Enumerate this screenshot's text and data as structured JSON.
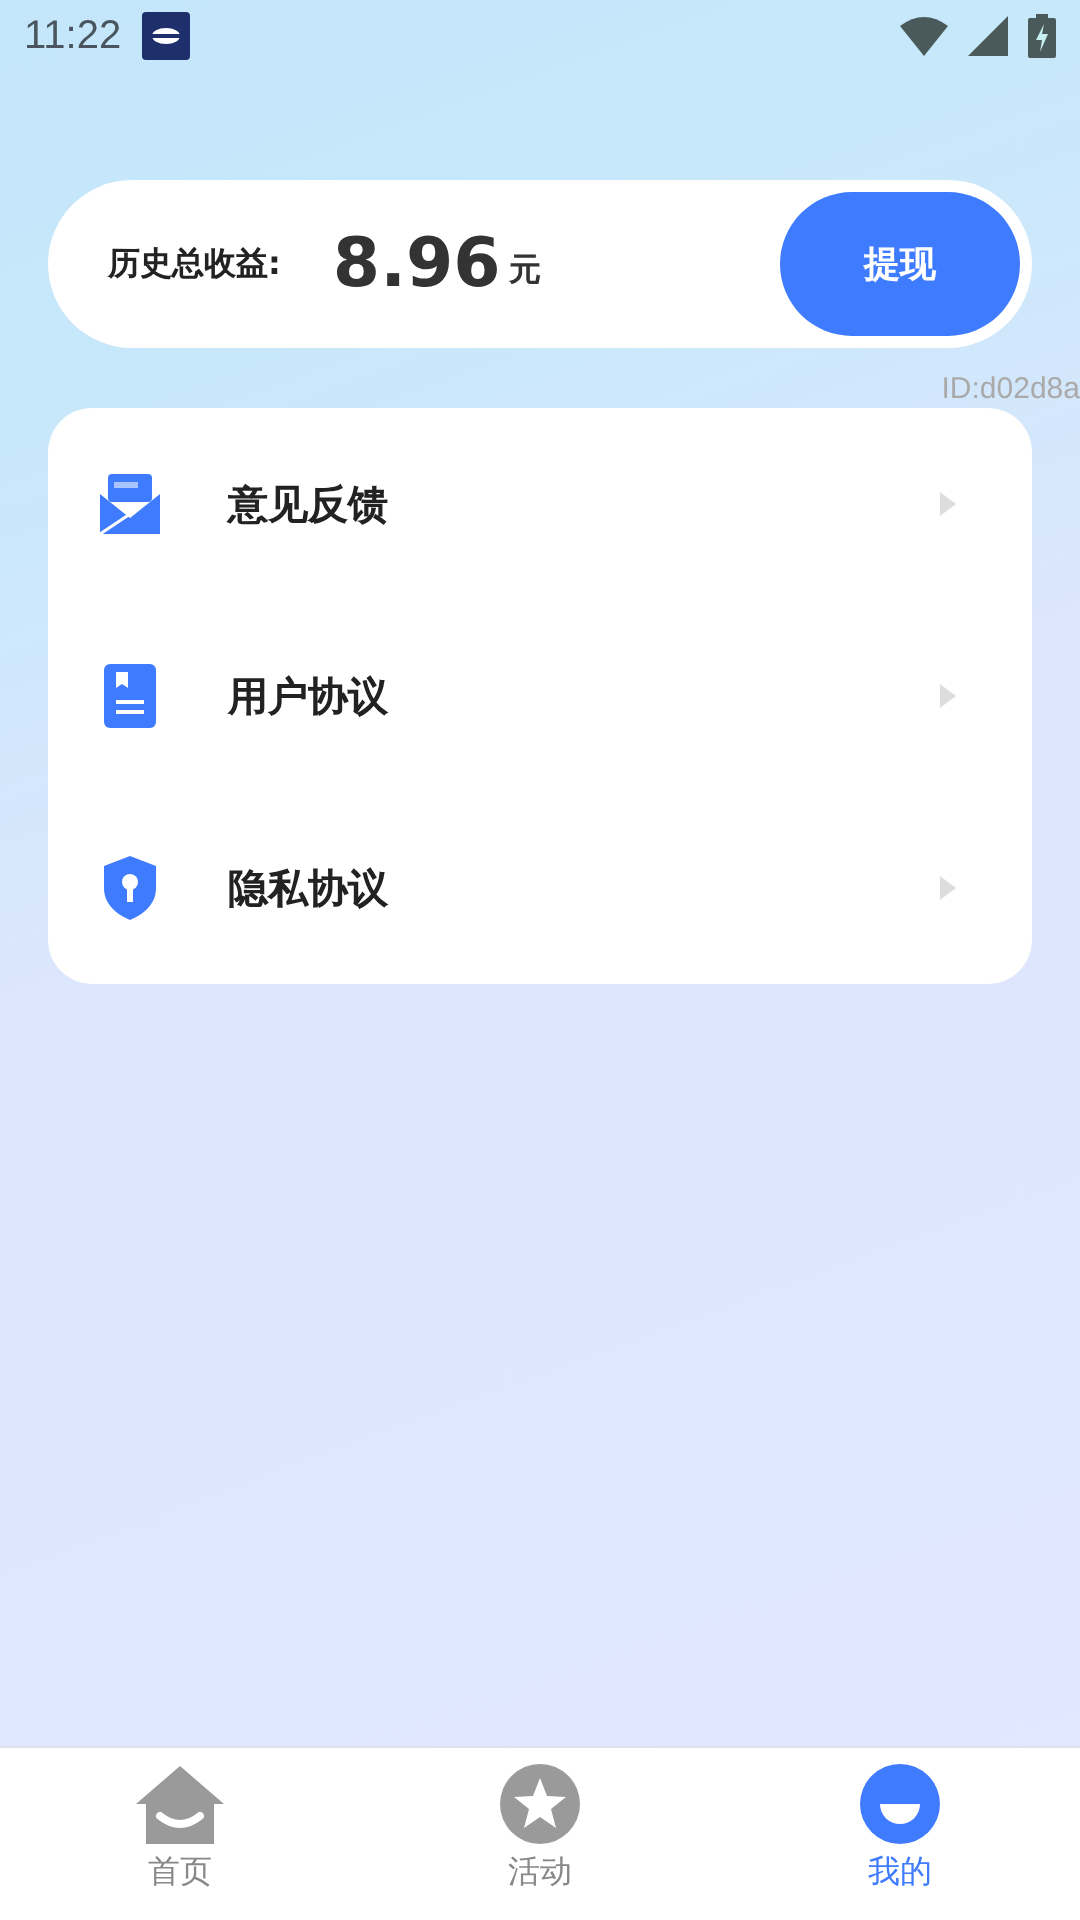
{
  "status_bar": {
    "time": "11:22"
  },
  "earnings": {
    "label": "历史总收益:",
    "amount": "8.96",
    "unit": "元",
    "button": "提现"
  },
  "user_id": "ID:d02d8a",
  "menu": [
    {
      "kind": "mail",
      "label": "意见反馈"
    },
    {
      "kind": "document",
      "label": "用户协议"
    },
    {
      "kind": "shield",
      "label": "隐私协议"
    }
  ],
  "tabs": [
    {
      "kind": "home",
      "label": "首页",
      "selected": false
    },
    {
      "kind": "star",
      "label": "活动",
      "selected": false
    },
    {
      "kind": "face",
      "label": "我的",
      "selected": true
    }
  ]
}
